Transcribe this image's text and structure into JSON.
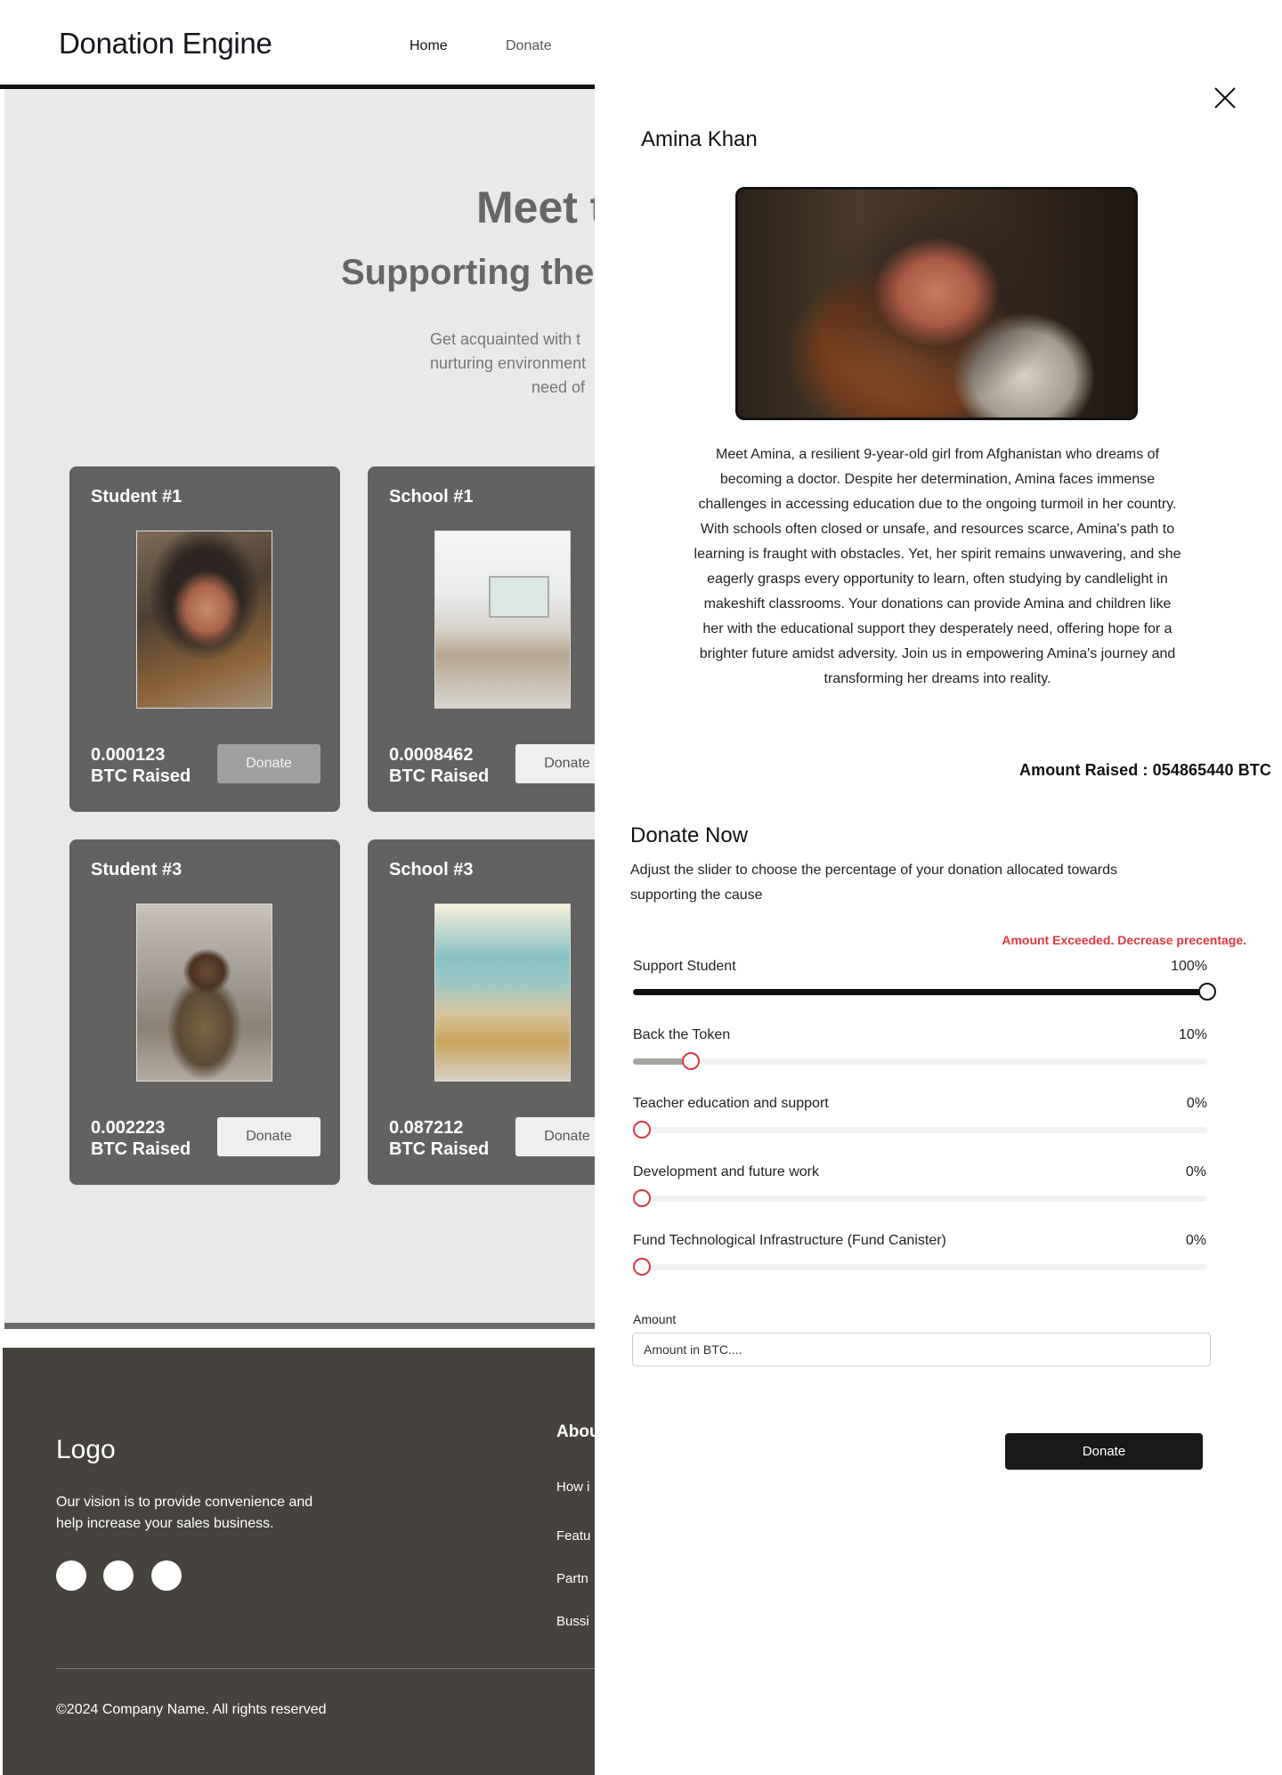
{
  "header": {
    "brand": "Donation Engine",
    "nav": {
      "home": "Home",
      "donate": "Donate"
    }
  },
  "hero": {
    "title": "Meet t",
    "subtitle": "Supporting the",
    "desc_lines": [
      "Get acquainted with t",
      "nurturing environment",
      "need of"
    ]
  },
  "cards": [
    {
      "title": "Student  #1",
      "amount": "0.000123",
      "unit": "BTC Raised",
      "button": "Donate",
      "photo": "girl-portrait"
    },
    {
      "title": "School  #1",
      "amount": "0.0008462",
      "unit": "BTC Raised",
      "button": "Donate",
      "photo": "classroom-map"
    },
    {
      "title": "Student  #3",
      "amount": "0.002223",
      "unit": "BTC Raised",
      "button": "Donate",
      "photo": "boy-portrait"
    },
    {
      "title": "School  #3",
      "amount": "0.087212",
      "unit": "BTC Raised",
      "button": "Donate",
      "photo": "classroom-colorful"
    }
  ],
  "footer": {
    "logo": "Logo",
    "tagline": "Our vision is to provide convenience and help increase your sales business.",
    "column_head": "Abou",
    "links": [
      "How i",
      "Featu",
      "Partn",
      "Bussi"
    ],
    "copyright": "©2024 Company Name. All rights reserved"
  },
  "drawer": {
    "close_icon": "close-icon",
    "name": "Amina Khan",
    "bio": "Meet Amina, a resilient 9-year-old girl from Afghanistan who dreams of becoming a doctor. Despite her determination, Amina faces immense challenges in accessing education due to the ongoing turmoil in her country. With schools often closed or unsafe, and resources scarce, Amina's path to learning is fraught with obstacles. Yet, her spirit remains unwavering, and she eagerly grasps every opportunity to learn, often studying by candlelight in makeshift classrooms. Your donations can provide Amina and children like her with the educational support they desperately need, offering hope for a brighter future amidst adversity. Join us in empowering Amina's journey and transforming her dreams into reality.",
    "amount_raised": "Amount Raised : 054865440 BTC",
    "donate_now": "Donate Now",
    "donate_desc": "Adjust the slider to choose the percentage of your donation allocated towards supporting the cause",
    "warning": "Amount Exceeded. Decrease precentage.",
    "warning_color": "#e0383e",
    "sliders": [
      {
        "label": "Support Student",
        "value": 100,
        "value_text": "100%"
      },
      {
        "label": "Back the Token",
        "value": 10,
        "value_text": "10%"
      },
      {
        "label": "Teacher education and support",
        "value": 0,
        "value_text": "0%"
      },
      {
        "label": "Development and future work",
        "value": 0,
        "value_text": "0%"
      },
      {
        "label": "Fund Technological Infrastructure (Fund Canister)",
        "value": 0,
        "value_text": "0%"
      }
    ],
    "amount_label": "Amount",
    "amount_placeholder": "Amount in BTC....",
    "submit": "Donate"
  }
}
